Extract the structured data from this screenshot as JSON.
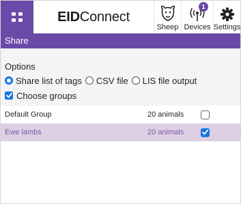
{
  "app": {
    "logo_bold": "EID",
    "logo_light": "Connect"
  },
  "toolbar": {
    "sheep_label": "Sheep",
    "devices_label": "Devices",
    "devices_badge": "1",
    "settings_label": "Settings"
  },
  "icons": {
    "menu": "grid-icon",
    "sheep": "sheep-icon",
    "devices": "antenna-icon",
    "settings": "gear-icon"
  },
  "page": {
    "title": "Share"
  },
  "options": {
    "heading": "Options",
    "radios": [
      {
        "label": "Share list of tags",
        "selected": true
      },
      {
        "label": "CSV file",
        "selected": false
      },
      {
        "label": "LIS file output",
        "selected": false
      }
    ],
    "choose_groups_label": "Choose groups",
    "choose_groups_checked": true
  },
  "groups": [
    {
      "name": "Default Group",
      "count": "20 animals",
      "checked": false
    },
    {
      "name": "Ewe lambs",
      "count": "20 animals",
      "checked": true
    }
  ],
  "colors": {
    "accent": "#6a4aa8",
    "selected_row": "#decfe4",
    "checkbox_blue": "#1677e0"
  }
}
